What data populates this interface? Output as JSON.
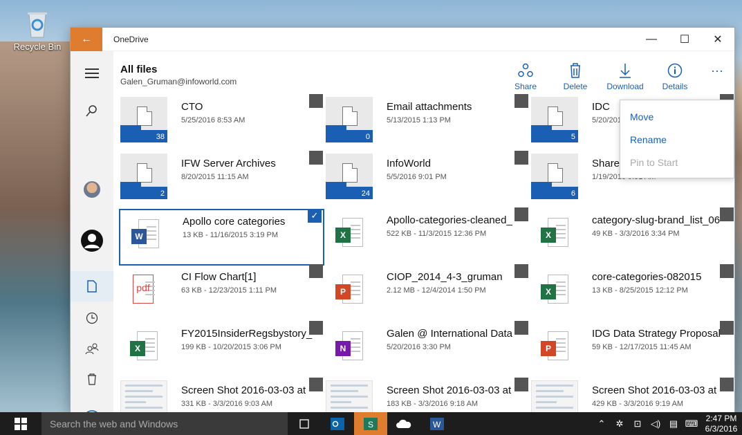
{
  "desktop": {
    "recycle_bin_label": "Recycle Bin"
  },
  "window": {
    "title": "OneDrive"
  },
  "header": {
    "title": "All files",
    "subtitle": "Galen_Gruman@infoworld.com"
  },
  "commands": {
    "share": "Share",
    "delete": "Delete",
    "download": "Download",
    "details": "Details",
    "more": "···"
  },
  "context_menu": {
    "move": "Move",
    "rename": "Rename",
    "pin": "Pin to Start"
  },
  "folders": [
    {
      "name": "CTO",
      "meta": "5/25/2016 8:53 AM",
      "count": "38"
    },
    {
      "name": "Email attachments",
      "meta": "5/13/2015 1:13 PM",
      "count": "0"
    },
    {
      "name": "IDC",
      "meta": "5/20/2016 9:00 AM",
      "count": "5"
    },
    {
      "name": "IFW Server Archives",
      "meta": "8/20/2015 11:15 AM",
      "count": "2"
    },
    {
      "name": "InfoWorld",
      "meta": "5/5/2016 9:01 PM",
      "count": "24"
    },
    {
      "name": "Shared",
      "meta": "1/19/2016 9:51 AM",
      "count": "6"
    }
  ],
  "files": [
    {
      "name": "Apollo core categories",
      "meta": "13 KB - 11/16/2015 3:19 PM",
      "type": "word",
      "badge": "W"
    },
    {
      "name": "Apollo-categories-cleaned_",
      "meta": "522 KB - 11/3/2015 12:36 PM",
      "type": "excel",
      "badge": "X"
    },
    {
      "name": "category-slug-brand_list_06",
      "meta": "49 KB - 3/3/2016 3:34 PM",
      "type": "excel",
      "badge": "X"
    },
    {
      "name": "CI Flow Chart[1]",
      "meta": "63 KB - 12/23/2015 1:11 PM",
      "type": "pdf",
      "badge": "pdf"
    },
    {
      "name": "CIOP_2014_4-3_gruman",
      "meta": "2.12 MB - 12/4/2014 1:50 PM",
      "type": "ppt",
      "badge": "P"
    },
    {
      "name": "core-categories-082015",
      "meta": "13 KB - 8/25/2015 12:12 PM",
      "type": "excel",
      "badge": "X"
    },
    {
      "name": "FY2015InsiderRegsbystory_g",
      "meta": "199 KB - 10/20/2015 3:06 PM",
      "type": "excel",
      "badge": "X"
    },
    {
      "name": "Galen @ International Data",
      "meta": "5/20/2016 3:30 PM",
      "type": "onenote",
      "badge": "N"
    },
    {
      "name": "IDG Data Strategy Proposal",
      "meta": "59 KB - 12/17/2015 11:45 AM",
      "type": "ppt",
      "badge": "P"
    },
    {
      "name": "Screen Shot 2016-03-03 at",
      "meta": "331 KB - 3/3/2016 9:03 AM",
      "type": "shot",
      "badge": ""
    },
    {
      "name": "Screen Shot 2016-03-03 at",
      "meta": "183 KB - 3/3/2016 9:18 AM",
      "type": "shot",
      "badge": ""
    },
    {
      "name": "Screen Shot 2016-03-03 at",
      "meta": "429 KB - 3/3/2016 9:19 AM",
      "type": "shot",
      "badge": ""
    }
  ],
  "taskbar": {
    "search_placeholder": "Search the web and Windows",
    "time": "2:47 PM",
    "date": "6/3/2016"
  },
  "colors": {
    "accent": "#1a5fb4",
    "title_accent": "#e07c2e",
    "word": "#2b579a",
    "excel": "#217346",
    "ppt": "#d24726",
    "onenote": "#7719aa"
  }
}
